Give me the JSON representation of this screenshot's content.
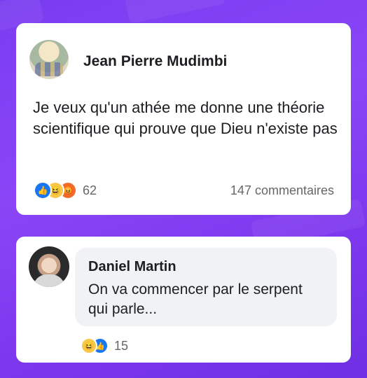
{
  "post": {
    "author": "Jean Pierre Mudimbi",
    "text": "Je veux qu'un athée me donne une théorie scientifique qui prouve que Dieu n'existe pas",
    "reactions_count": "62",
    "comments_count": "147 commentaires",
    "reaction_icons": [
      "like-icon",
      "haha-icon",
      "angry-icon"
    ]
  },
  "comment": {
    "author": "Daniel Martin",
    "text": "On va commencer par le serpent qui parle...",
    "reactions_count": "15",
    "reaction_icons": [
      "haha-icon",
      "like-icon"
    ]
  },
  "colors": {
    "background": "#7d3cf0",
    "like": "#1877f2",
    "haha": "#f7c84a",
    "angry": "#f26b2a"
  }
}
